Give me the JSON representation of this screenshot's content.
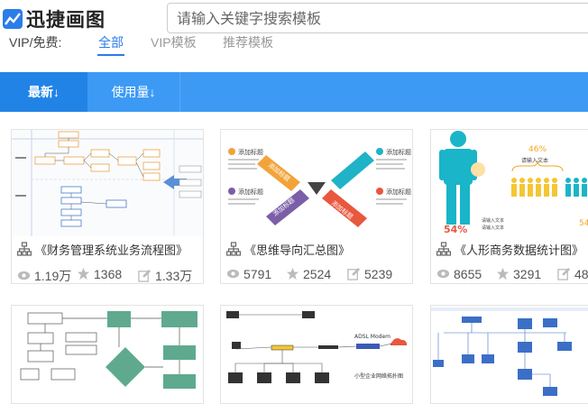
{
  "header": {
    "logo_text": "迅捷画图",
    "search_placeholder": "请输入关键字搜索模板"
  },
  "filter": {
    "label": "VIP/免费:",
    "options": [
      "全部",
      "VIP模板",
      "推荐模板"
    ]
  },
  "sort": {
    "tabs": [
      "最新↓",
      "使用量↓"
    ]
  },
  "cards": [
    {
      "title": "《财务管理系统业务流程图》",
      "views": "1.19万",
      "likes": "1368",
      "edits": "1.33万"
    },
    {
      "title": "《思维导向汇总图》",
      "views": "5791",
      "likes": "2524",
      "edits": "5239"
    },
    {
      "title": "《人形商务数据统计图》",
      "views": "8655",
      "likes": "3291",
      "edits": "48"
    }
  ],
  "thumb_text": {
    "mind_label": "添加标题",
    "pct_46": "46%",
    "pct_54a": "54%",
    "pct_54b": "54",
    "input_text": "请输入文本",
    "adsl": "ADSL Modem",
    "caption": "小型企业网络拓扑图"
  },
  "colors": {
    "brand_blue": "#3c9af5",
    "active_tab": "#2283e6",
    "link_blue": "#2b7de9",
    "orange": "#f5a623",
    "teal": "#1ab5c8"
  }
}
